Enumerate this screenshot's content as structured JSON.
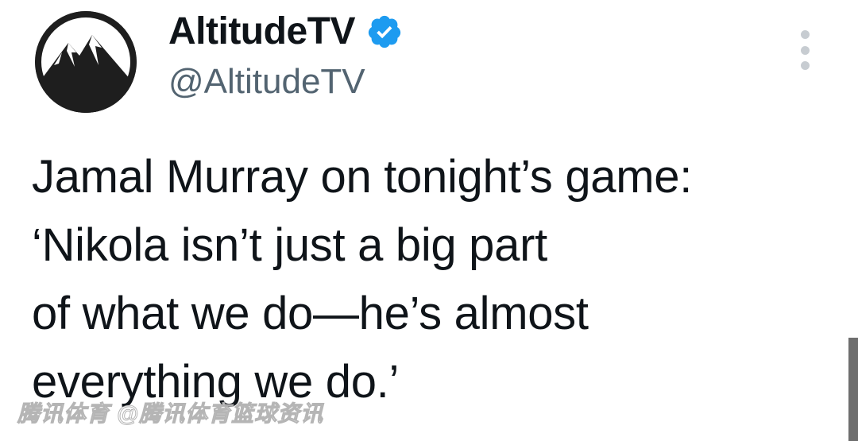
{
  "account": {
    "display_name": "AltitudeTV",
    "handle": "@AltitudeTV",
    "avatar_icon": "mountain-logo-icon",
    "verified_icon": "verified-badge-icon",
    "verified_color": "#1d9bf0"
  },
  "menu": {
    "icon": "more-options-icon"
  },
  "tweet": {
    "lines": [
      "Jamal Murray on tonight’s game:",
      "‘Nikola isn’t just a big part",
      "of what we do—he’s almost",
      "everything we do.’"
    ]
  },
  "watermark": {
    "text": "腾讯体育 @腾讯体育篮球资讯"
  },
  "colors": {
    "text": "#0f1419",
    "secondary": "#536471",
    "avatar_bg": "#222222"
  }
}
